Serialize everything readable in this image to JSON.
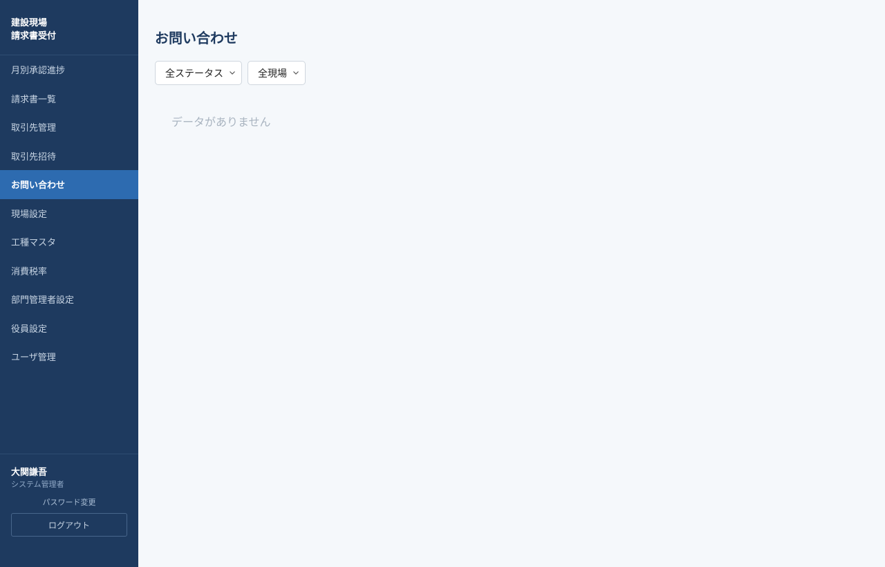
{
  "brand": {
    "line1": "建設現場",
    "line2": "請求書受付"
  },
  "nav": {
    "items": [
      {
        "label": "月別承認進捗"
      },
      {
        "label": "請求書一覧"
      },
      {
        "label": "取引先管理"
      },
      {
        "label": "取引先招待"
      },
      {
        "label": "お問い合わせ",
        "active": true
      },
      {
        "label": "現場設定"
      },
      {
        "label": "工種マスタ"
      },
      {
        "label": "消費税率"
      },
      {
        "label": "部門管理者設定"
      },
      {
        "label": "役員設定"
      },
      {
        "label": "ユーザ管理"
      }
    ]
  },
  "user": {
    "name": "大関謙吾",
    "role": "システム管理者",
    "password_link": "パスワード変更",
    "logout_label": "ログアウト"
  },
  "main": {
    "title": "お問い合わせ",
    "filters": {
      "status": {
        "selected": "全ステータス",
        "icon": "chevron-down-icon"
      },
      "site": {
        "selected": "全現場",
        "icon": "chevron-down-icon"
      }
    },
    "empty_message": "データがありません"
  },
  "colors": {
    "sidebar_bg": "#1e3a5f",
    "active_bg": "#2d6bb0",
    "page_bg": "#f5f8fb",
    "title": "#1e3a5f"
  }
}
